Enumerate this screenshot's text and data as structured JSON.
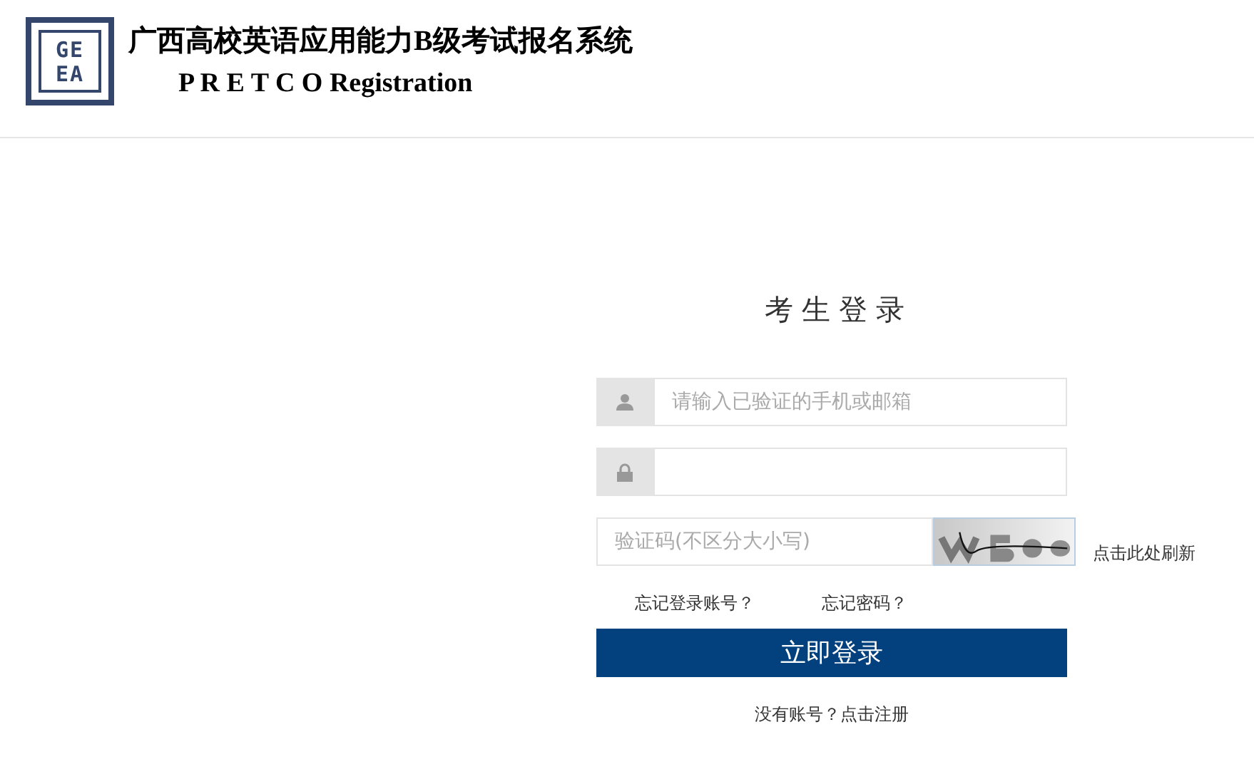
{
  "header": {
    "logo_lines": [
      "GE",
      "EA"
    ],
    "title": "广西高校英语应用能力B级考试报名系统",
    "subtitle": "P R E T C O Registration"
  },
  "login": {
    "heading": "考生登录",
    "fields": [
      {
        "kind": "account",
        "placeholder": "请输入已验证的手机或邮箱"
      },
      {
        "kind": "password"
      },
      {
        "kind": "captcha",
        "placeholder": "验证码(不区分大小写)"
      }
    ],
    "refresh_link": "点击此处刷新",
    "forgot_account": "忘记登录账号？",
    "forgot_password": "忘记密码？",
    "submit": "立即登录",
    "register": "没有账号？点击注册"
  }
}
